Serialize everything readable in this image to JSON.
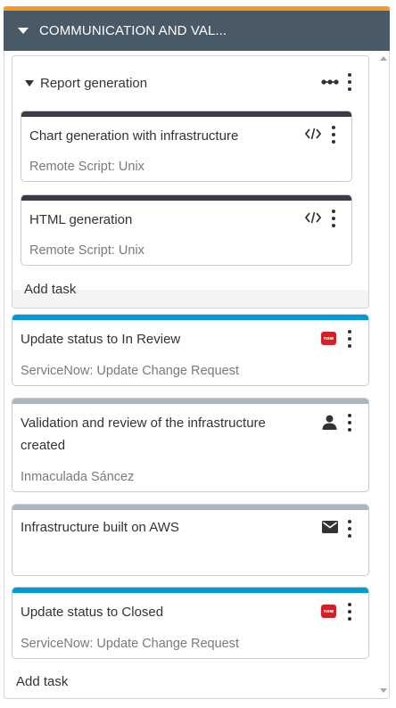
{
  "phase": {
    "title": "COMMUNICATION AND VAL...",
    "accent": "#f59a23",
    "header_bg": "#495966"
  },
  "group": {
    "title": "Report generation",
    "tasks": [
      {
        "title": "Chart generation with infrastructure",
        "subtitle": "Remote Script: Unix",
        "icon": "code-icon",
        "color": "#3a3a48"
      },
      {
        "title": "HTML generation",
        "subtitle": "Remote Script: Unix",
        "icon": "code-icon",
        "color": "#3a3a48"
      }
    ],
    "add_task": "Add task"
  },
  "tasks": [
    {
      "title": "Update status to In Review",
      "subtitle": "ServiceNow: Update Change Request",
      "icon": "servicenow-icon",
      "badge": "now",
      "color": "#009ad9"
    },
    {
      "title_line1": "Validation and review of the infrastructure",
      "title_line2": "created",
      "subtitle": "Inmaculada Sáncez",
      "icon": "user-icon",
      "color": "#adb5bd"
    },
    {
      "title": "Infrastructure built on AWS",
      "subtitle": "",
      "icon": "mail-icon",
      "color": "#adb5bd"
    },
    {
      "title": "Update status to Closed",
      "subtitle": "ServiceNow: Update Change Request",
      "icon": "servicenow-icon",
      "badge": "now",
      "color": "#009ad9"
    }
  ],
  "add_task": "Add task"
}
